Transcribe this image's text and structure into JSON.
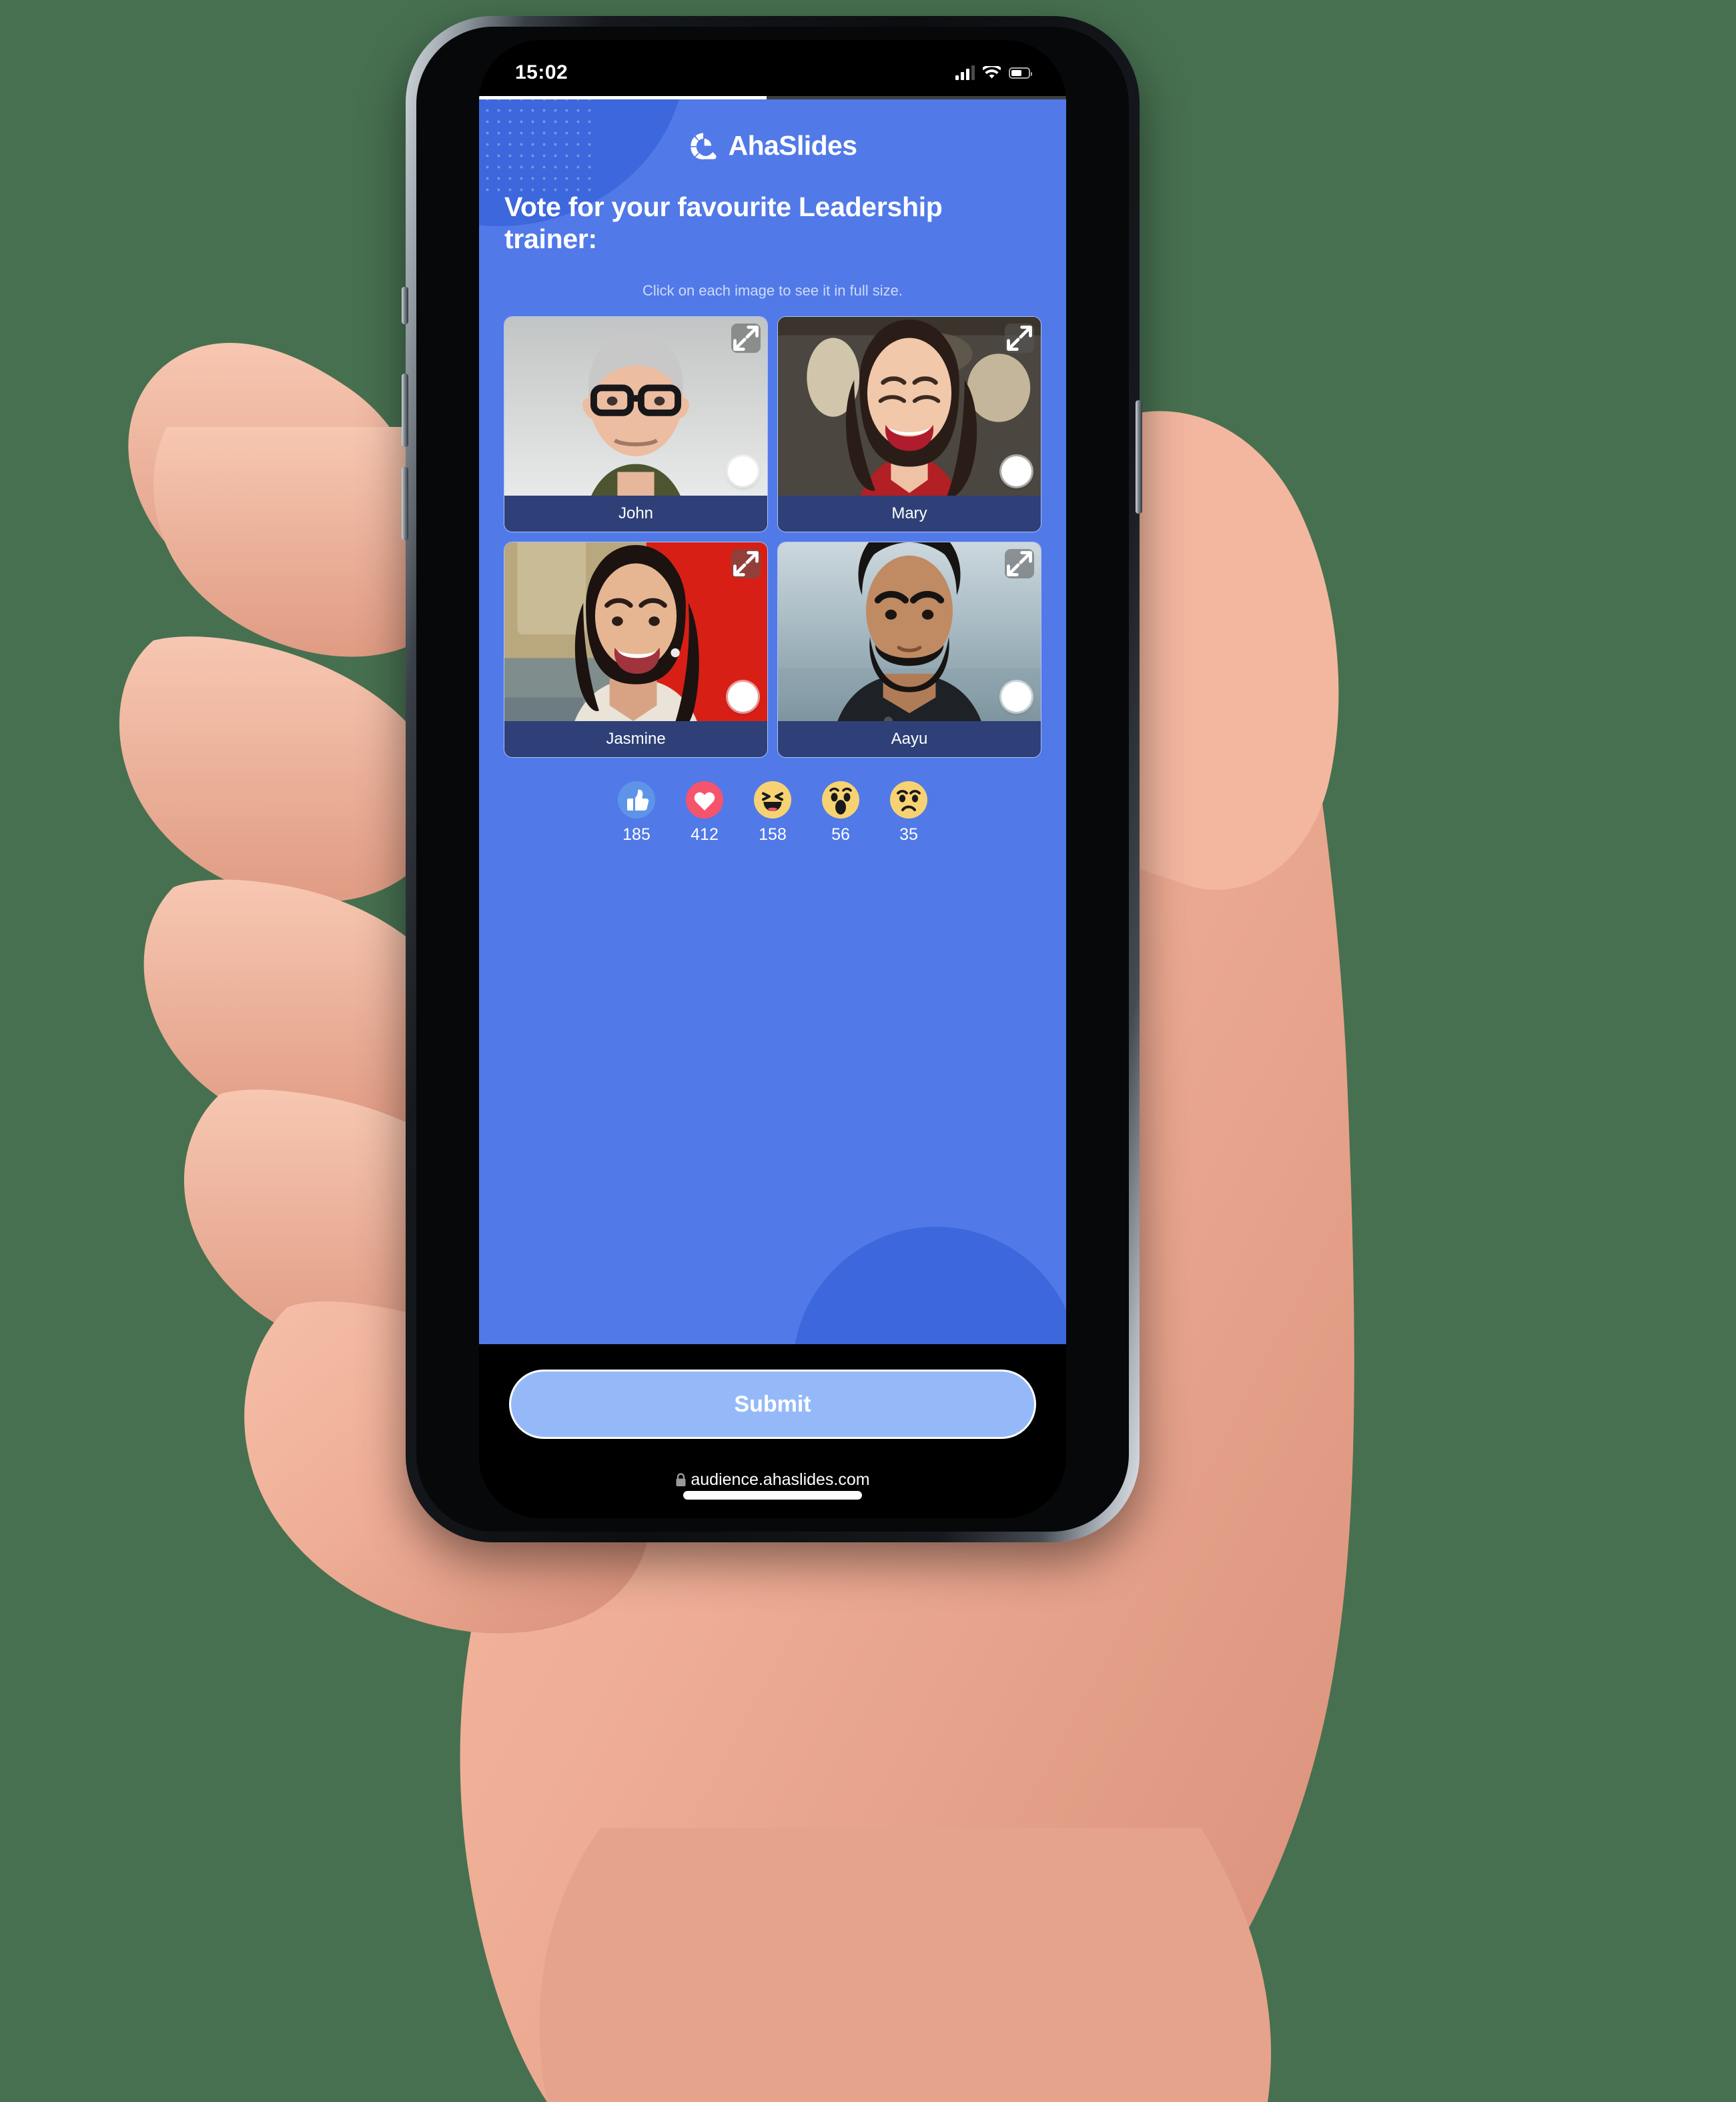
{
  "background_color": "#477050",
  "status_bar": {
    "time": "15:02",
    "signal_icon": "cellular-signal-icon",
    "wifi_icon": "wifi-icon",
    "battery_icon": "battery-icon",
    "signal_bars_filled": 3,
    "signal_bars_total": 4
  },
  "brand": {
    "logo_icon": "ahaslides-logo-icon",
    "name": "AhaSlides",
    "accent_color": "#5179E8"
  },
  "poll": {
    "title": "Vote for your favourite Leadership trainer:",
    "instruction": "Click on each image to see it in full size.",
    "expand_icon": "expand-arrows-icon",
    "radio_icon": "radio-unselected-icon",
    "options": [
      {
        "name": "John",
        "selected": false
      },
      {
        "name": "Mary",
        "selected": false
      },
      {
        "name": "Jasmine",
        "selected": false
      },
      {
        "name": "Aayu",
        "selected": false
      }
    ]
  },
  "reactions": [
    {
      "icon": "thumbs-up-icon",
      "count": "185",
      "color": "#5D94E8"
    },
    {
      "icon": "heart-icon",
      "count": "412",
      "color": "#F5546D"
    },
    {
      "icon": "laughing-face-icon",
      "count": "158",
      "color": "#F7D272"
    },
    {
      "icon": "surprised-face-icon",
      "count": "56",
      "color": "#F7D272"
    },
    {
      "icon": "sad-face-icon",
      "count": "35",
      "color": "#F7D272"
    }
  ],
  "submit": {
    "label": "Submit",
    "color": "#95B9F8"
  },
  "browser": {
    "lock_icon": "lock-icon",
    "url": "audience.ahaslides.com"
  }
}
